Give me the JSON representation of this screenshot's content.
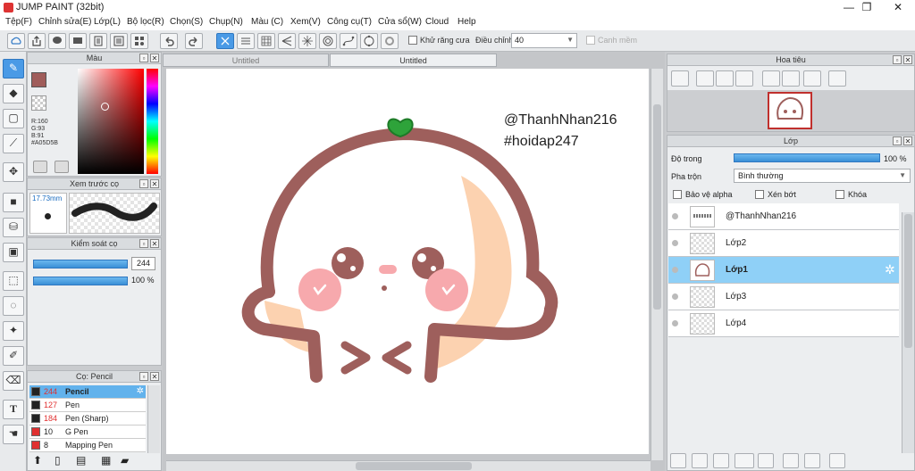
{
  "window": {
    "title": "JUMP PAINT (32bit)",
    "minimize": "—",
    "restore": "❐",
    "close": "✕"
  },
  "menu": [
    "Tệp(F)",
    "Chỉnh sửa(E)",
    "Lớp(L)",
    "Bộ lọc(R)",
    "Chọn(S)",
    "Chụp(N)",
    "Màu (C)",
    "Xem(V)",
    "Công cụ(T)",
    "Cửa sổ(W)",
    "Cloud",
    "Help"
  ],
  "toolbar": {
    "antialias_label": "Khử răng cưa",
    "adjust_label": "Điều chỉnh",
    "adjust_value": "40",
    "snap_label": "Canh mềm"
  },
  "color_panel": {
    "title": "Màu",
    "r": "R:160",
    "g": "G:93",
    "b": "B:91",
    "hex": "#A05D5B",
    "main_color": "#a05d5b"
  },
  "brush_preview": {
    "title": "Xem trước cọ",
    "size": "17.73mm"
  },
  "brush_control": {
    "title": "Kiểm soát cọ",
    "size_value": "244",
    "opacity_value": "100 %",
    "size_fill": 1.0,
    "opacity_fill": 1.0
  },
  "brush_list": {
    "title": "Cọ: Pencil",
    "items": [
      {
        "size": "244",
        "name": "Pencil",
        "color": "#222222"
      },
      {
        "size": "127",
        "name": "Pen",
        "color": "#222222"
      },
      {
        "size": "184",
        "name": "Pen (Sharp)",
        "color": "#222222"
      },
      {
        "size": "10",
        "name": "G Pen",
        "color": "#e03030"
      },
      {
        "size": "8",
        "name": "Mapping Pen",
        "color": "#e03030"
      }
    ]
  },
  "documents": {
    "tab1": "Untitled",
    "tab2": "Untitled"
  },
  "canvas_text": {
    "line1": "@ThanhNhan216",
    "line2": "#hoidap247"
  },
  "navigator": {
    "title": "Hoa tiêu"
  },
  "layers_panel": {
    "title": "Lớp",
    "opacity_label": "Độ trong",
    "opacity_value": "100 %",
    "opacity_fill": 1.0,
    "blend_label": "Pha trộn",
    "blend_value": "Bình thường",
    "protect_alpha": "Bảo vệ alpha",
    "clipping": "Xén bớt",
    "lock": "Khóa",
    "layers": [
      {
        "name": "@ThanhNhan216"
      },
      {
        "name": "Lớp2"
      },
      {
        "name": "Lớp1"
      },
      {
        "name": "Lớp3"
      },
      {
        "name": "Lớp4"
      }
    ]
  }
}
